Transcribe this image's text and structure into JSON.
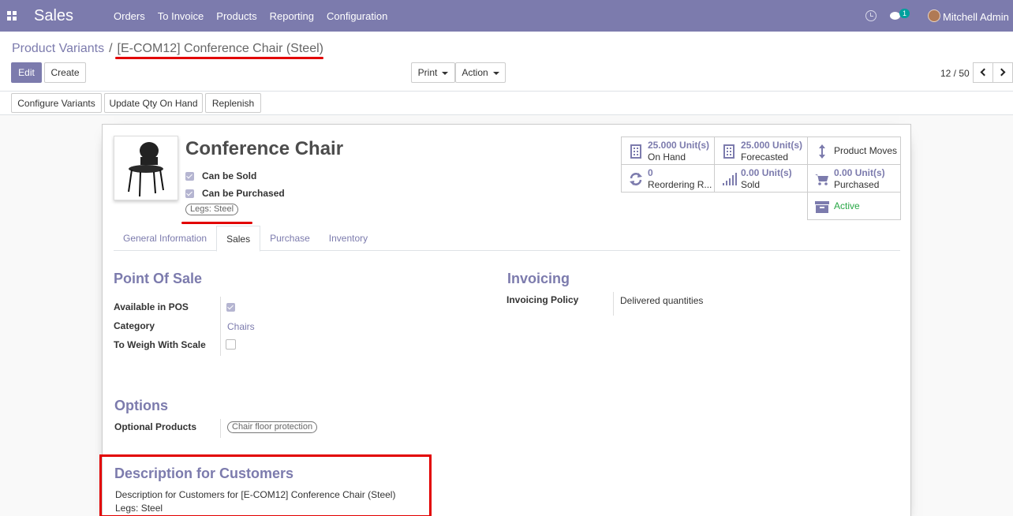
{
  "navbar": {
    "app_name": "Sales",
    "menu": [
      "Orders",
      "To Invoice",
      "Products",
      "Reporting",
      "Configuration"
    ],
    "chat_count": "1",
    "user_name": "Mitchell Admin"
  },
  "breadcrumb": {
    "parent": "Product Variants",
    "separator": "/",
    "current": "[E-COM12] Conference Chair (Steel)"
  },
  "buttons": {
    "edit": "Edit",
    "create": "Create",
    "print": "Print",
    "action": "Action",
    "configure_variants": "Configure Variants",
    "update_qty": "Update Qty On Hand",
    "replenish": "Replenish"
  },
  "pager": {
    "value": "12 / 50"
  },
  "product": {
    "name": "Conference Chair",
    "can_be_sold": "Can be Sold",
    "can_be_purchased": "Can be Purchased",
    "attribute_tag": "Legs: Steel"
  },
  "smart_buttons": {
    "on_hand_value": "25.000 Unit(s)",
    "on_hand_label": "On Hand",
    "forecasted_value": "25.000 Unit(s)",
    "forecasted_label": "Forecasted",
    "product_moves": "Product Moves",
    "reordering_value": "0",
    "reordering_label": "Reordering R...",
    "sold_value": "0.00 Unit(s)",
    "sold_label": "Sold",
    "purchased_value": "0.00 Unit(s)",
    "purchased_label": "Purchased",
    "active": "Active"
  },
  "tabs": [
    "General Information",
    "Sales",
    "Purchase",
    "Inventory"
  ],
  "pos": {
    "title": "Point Of Sale",
    "available_label": "Available in POS",
    "category_label": "Category",
    "category_value": "Chairs",
    "weigh_label": "To Weigh With Scale"
  },
  "invoicing": {
    "title": "Invoicing",
    "policy_label": "Invoicing Policy",
    "policy_value": "Delivered quantities"
  },
  "options": {
    "title": "Options",
    "optional_label": "Optional Products",
    "optional_value": "Chair floor protection"
  },
  "description": {
    "title": "Description for Customers",
    "line1": "Description for Customers for [E-COM12] Conference Chair (Steel)",
    "line2": "Legs: Steel"
  },
  "colors": {
    "brand": "#7c7bad",
    "highlight": "#e20000",
    "active": "#28a745"
  }
}
